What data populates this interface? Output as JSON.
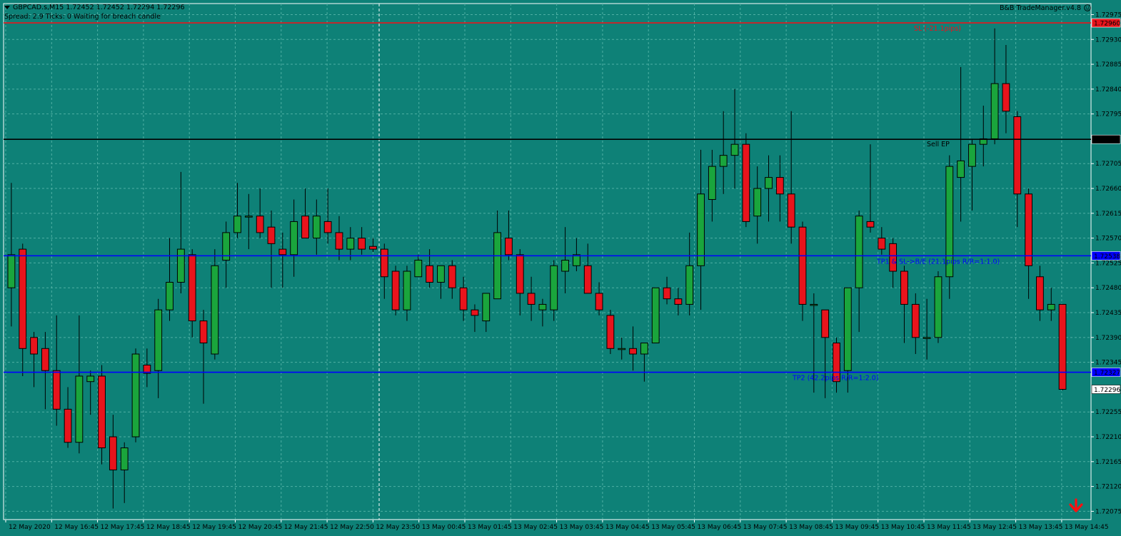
{
  "header": {
    "symbol_line": "GBPCAD.s,M15  1.72452 1.72452 1.72294 1.72296",
    "status_line": "Spread: 2.9   Ticks: 0   Waiting for breach candle",
    "trade_manager": "B&B TradeManager.v4.8"
  },
  "colors": {
    "background": "#0e8177",
    "grid": "#4fb0a4",
    "bull": "#1aa53c",
    "bear": "#e8141c",
    "sl_line": "#e8141c",
    "entry_line": "#000000",
    "tp_line": "#0000ff"
  },
  "levels": {
    "sl": {
      "price": 1.7296,
      "label": "SL (-21.1pips)",
      "axis_tag": "1.72960"
    },
    "entry": {
      "price": 1.72749,
      "label": "Sell EP",
      "axis_tag": "1.72749"
    },
    "tp1": {
      "price": 1.72538,
      "label": "TP1 & SL->B/E (21.1pips R/R=1:1.0)",
      "axis_tag": "1.72538"
    },
    "tp2": {
      "price": 1.72327,
      "label": "TP2 (42.2pips R/R=1:2.0)",
      "axis_tag": "1.72327"
    },
    "bid": {
      "price": 1.72296,
      "axis_tag": "1.72296"
    }
  },
  "price_axis": {
    "min": 1.7206,
    "max": 1.72995,
    "ticks": [
      "1.72975",
      "1.72930",
      "1.72885",
      "1.72840",
      "1.72795",
      "1.72705",
      "1.72660",
      "1.72615",
      "1.72570",
      "1.72525",
      "1.72480",
      "1.72435",
      "1.72390",
      "1.72345",
      "1.72255",
      "1.72210",
      "1.72165",
      "1.72120",
      "1.72075"
    ]
  },
  "time_axis": {
    "labels": [
      "12 May 2020",
      "12 May 16:45",
      "12 May 17:45",
      "12 May 18:45",
      "12 May 19:45",
      "12 May 20:45",
      "12 May 21:45",
      "12 May 22:50",
      "12 May 23:50",
      "13 May 00:45",
      "13 May 01:45",
      "13 May 02:45",
      "13 May 03:45",
      "13 May 04:45",
      "13 May 05:45",
      "13 May 06:45",
      "13 May 07:45",
      "13 May 08:45",
      "13 May 09:45",
      "13 May 10:45",
      "13 May 11:45",
      "13 May 12:45",
      "13 May 13:45",
      "13 May 14:45"
    ]
  },
  "chart_data": {
    "type": "candlestick",
    "series": [
      {
        "o": 1.7248,
        "h": 1.7267,
        "l": 1.7241,
        "c": 1.7254
      },
      {
        "o": 1.7255,
        "h": 1.7256,
        "l": 1.7232,
        "c": 1.7237
      },
      {
        "o": 1.7239,
        "h": 1.724,
        "l": 1.723,
        "c": 1.7236
      },
      {
        "o": 1.7237,
        "h": 1.724,
        "l": 1.7226,
        "c": 1.7233
      },
      {
        "o": 1.7233,
        "h": 1.7243,
        "l": 1.7223,
        "c": 1.7226
      },
      {
        "o": 1.7226,
        "h": 1.723,
        "l": 1.7219,
        "c": 1.722
      },
      {
        "o": 1.722,
        "h": 1.7243,
        "l": 1.7218,
        "c": 1.7232
      },
      {
        "o": 1.7231,
        "h": 1.7233,
        "l": 1.7225,
        "c": 1.7232
      },
      {
        "o": 1.7232,
        "h": 1.7234,
        "l": 1.7216,
        "c": 1.7219
      },
      {
        "o": 1.7221,
        "h": 1.7225,
        "l": 1.7208,
        "c": 1.7215
      },
      {
        "o": 1.7215,
        "h": 1.722,
        "l": 1.7209,
        "c": 1.7219
      },
      {
        "o": 1.7221,
        "h": 1.7237,
        "l": 1.722,
        "c": 1.7236
      },
      {
        "o": 1.7234,
        "h": 1.7237,
        "l": 1.723,
        "c": 1.72325
      },
      {
        "o": 1.7233,
        "h": 1.7246,
        "l": 1.7228,
        "c": 1.7244
      },
      {
        "o": 1.7244,
        "h": 1.7257,
        "l": 1.7242,
        "c": 1.7249
      },
      {
        "o": 1.7249,
        "h": 1.7269,
        "l": 1.7247,
        "c": 1.7255
      },
      {
        "o": 1.7254,
        "h": 1.7255,
        "l": 1.7239,
        "c": 1.7242
      },
      {
        "o": 1.7242,
        "h": 1.7244,
        "l": 1.7227,
        "c": 1.7238
      },
      {
        "o": 1.7236,
        "h": 1.7255,
        "l": 1.7235,
        "c": 1.7252
      },
      {
        "o": 1.7253,
        "h": 1.726,
        "l": 1.7248,
        "c": 1.7258
      },
      {
        "o": 1.7258,
        "h": 1.7267,
        "l": 1.7257,
        "c": 1.7261
      },
      {
        "o": 1.7261,
        "h": 1.7265,
        "l": 1.7255,
        "c": 1.7261
      },
      {
        "o": 1.7261,
        "h": 1.7266,
        "l": 1.7257,
        "c": 1.7258
      },
      {
        "o": 1.7259,
        "h": 1.7262,
        "l": 1.7248,
        "c": 1.7256
      },
      {
        "o": 1.7255,
        "h": 1.7258,
        "l": 1.7248,
        "c": 1.7254
      },
      {
        "o": 1.7254,
        "h": 1.7264,
        "l": 1.725,
        "c": 1.726
      },
      {
        "o": 1.7261,
        "h": 1.7266,
        "l": 1.7257,
        "c": 1.7257
      },
      {
        "o": 1.7257,
        "h": 1.7264,
        "l": 1.7254,
        "c": 1.7261
      },
      {
        "o": 1.726,
        "h": 1.7266,
        "l": 1.7256,
        "c": 1.7258
      },
      {
        "o": 1.7258,
        "h": 1.7261,
        "l": 1.7253,
        "c": 1.7255
      },
      {
        "o": 1.7255,
        "h": 1.7259,
        "l": 1.7253,
        "c": 1.7257
      },
      {
        "o": 1.7257,
        "h": 1.7259,
        "l": 1.7254,
        "c": 1.7255
      },
      {
        "o": 1.72555,
        "h": 1.7257,
        "l": 1.72545,
        "c": 1.7255
      },
      {
        "o": 1.7255,
        "h": 1.7256,
        "l": 1.7246,
        "c": 1.725
      },
      {
        "o": 1.7251,
        "h": 1.7252,
        "l": 1.7243,
        "c": 1.7244
      },
      {
        "o": 1.7244,
        "h": 1.7252,
        "l": 1.7242,
        "c": 1.7251
      },
      {
        "o": 1.725,
        "h": 1.7254,
        "l": 1.725,
        "c": 1.7253
      },
      {
        "o": 1.7252,
        "h": 1.7255,
        "l": 1.7248,
        "c": 1.7249
      },
      {
        "o": 1.7249,
        "h": 1.7252,
        "l": 1.7246,
        "c": 1.7252
      },
      {
        "o": 1.7252,
        "h": 1.7253,
        "l": 1.7246,
        "c": 1.7248
      },
      {
        "o": 1.7248,
        "h": 1.725,
        "l": 1.7242,
        "c": 1.7244
      },
      {
        "o": 1.7244,
        "h": 1.7245,
        "l": 1.724,
        "c": 1.7243
      },
      {
        "o": 1.7242,
        "h": 1.7247,
        "l": 1.724,
        "c": 1.7247
      },
      {
        "o": 1.7246,
        "h": 1.7262,
        "l": 1.7246,
        "c": 1.7258
      },
      {
        "o": 1.7257,
        "h": 1.7262,
        "l": 1.7253,
        "c": 1.7254
      },
      {
        "o": 1.7254,
        "h": 1.7255,
        "l": 1.7243,
        "c": 1.7247
      },
      {
        "o": 1.7247,
        "h": 1.725,
        "l": 1.7242,
        "c": 1.7245
      },
      {
        "o": 1.7244,
        "h": 1.7246,
        "l": 1.7241,
        "c": 1.7245
      },
      {
        "o": 1.7244,
        "h": 1.7253,
        "l": 1.7242,
        "c": 1.7252
      },
      {
        "o": 1.7251,
        "h": 1.7259,
        "l": 1.7247,
        "c": 1.7253
      },
      {
        "o": 1.7252,
        "h": 1.7257,
        "l": 1.7251,
        "c": 1.7254
      },
      {
        "o": 1.7252,
        "h": 1.7256,
        "l": 1.7247,
        "c": 1.7247
      },
      {
        "o": 1.7247,
        "h": 1.7249,
        "l": 1.7243,
        "c": 1.7244
      },
      {
        "o": 1.7243,
        "h": 1.7244,
        "l": 1.7236,
        "c": 1.7237
      },
      {
        "o": 1.7237,
        "h": 1.7239,
        "l": 1.7235,
        "c": 1.7237
      },
      {
        "o": 1.7237,
        "h": 1.7241,
        "l": 1.7233,
        "c": 1.7236
      },
      {
        "o": 1.7236,
        "h": 1.7238,
        "l": 1.7231,
        "c": 1.7238
      },
      {
        "o": 1.7238,
        "h": 1.7248,
        "l": 1.7238,
        "c": 1.7248
      },
      {
        "o": 1.7248,
        "h": 1.725,
        "l": 1.7245,
        "c": 1.7246
      },
      {
        "o": 1.7246,
        "h": 1.7248,
        "l": 1.7243,
        "c": 1.7245
      },
      {
        "o": 1.7245,
        "h": 1.7258,
        "l": 1.7243,
        "c": 1.7252
      },
      {
        "o": 1.7252,
        "h": 1.7273,
        "l": 1.7244,
        "c": 1.7265
      },
      {
        "o": 1.7264,
        "h": 1.7273,
        "l": 1.726,
        "c": 1.727
      },
      {
        "o": 1.727,
        "h": 1.728,
        "l": 1.7265,
        "c": 1.7272
      },
      {
        "o": 1.7272,
        "h": 1.7284,
        "l": 1.7266,
        "c": 1.7274
      },
      {
        "o": 1.7274,
        "h": 1.7276,
        "l": 1.7259,
        "c": 1.726
      },
      {
        "o": 1.7261,
        "h": 1.727,
        "l": 1.7256,
        "c": 1.7266
      },
      {
        "o": 1.7266,
        "h": 1.7272,
        "l": 1.726,
        "c": 1.7268
      },
      {
        "o": 1.7268,
        "h": 1.7272,
        "l": 1.726,
        "c": 1.7265
      },
      {
        "o": 1.7265,
        "h": 1.728,
        "l": 1.7256,
        "c": 1.7259
      },
      {
        "o": 1.7259,
        "h": 1.726,
        "l": 1.7242,
        "c": 1.7245
      },
      {
        "o": 1.7245,
        "h": 1.7247,
        "l": 1.7229,
        "c": 1.7245
      },
      {
        "o": 1.7244,
        "h": 1.7244,
        "l": 1.7228,
        "c": 1.7239
      },
      {
        "o": 1.7238,
        "h": 1.7239,
        "l": 1.7229,
        "c": 1.7231
      },
      {
        "o": 1.7233,
        "h": 1.7248,
        "l": 1.7229,
        "c": 1.7248
      },
      {
        "o": 1.7248,
        "h": 1.7262,
        "l": 1.724,
        "c": 1.7261
      },
      {
        "o": 1.726,
        "h": 1.7274,
        "l": 1.7258,
        "c": 1.7259
      },
      {
        "o": 1.7257,
        "h": 1.7259,
        "l": 1.7254,
        "c": 1.7255
      },
      {
        "o": 1.7256,
        "h": 1.7257,
        "l": 1.7248,
        "c": 1.7251
      },
      {
        "o": 1.7251,
        "h": 1.7252,
        "l": 1.7238,
        "c": 1.7245
      },
      {
        "o": 1.7245,
        "h": 1.7247,
        "l": 1.7236,
        "c": 1.7239
      },
      {
        "o": 1.7239,
        "h": 1.7246,
        "l": 1.7235,
        "c": 1.7239
      },
      {
        "o": 1.7239,
        "h": 1.7251,
        "l": 1.7238,
        "c": 1.725
      },
      {
        "o": 1.725,
        "h": 1.7272,
        "l": 1.7246,
        "c": 1.727
      },
      {
        "o": 1.7268,
        "h": 1.7288,
        "l": 1.726,
        "c": 1.7271
      },
      {
        "o": 1.727,
        "h": 1.7275,
        "l": 1.7262,
        "c": 1.7274
      },
      {
        "o": 1.7274,
        "h": 1.7281,
        "l": 1.727,
        "c": 1.7275
      },
      {
        "o": 1.7275,
        "h": 1.7295,
        "l": 1.7274,
        "c": 1.7285
      },
      {
        "o": 1.7285,
        "h": 1.7292,
        "l": 1.7276,
        "c": 1.728
      },
      {
        "o": 1.7279,
        "h": 1.728,
        "l": 1.7259,
        "c": 1.7265
      },
      {
        "o": 1.7265,
        "h": 1.7266,
        "l": 1.7246,
        "c": 1.7252
      },
      {
        "o": 1.725,
        "h": 1.7252,
        "l": 1.7242,
        "c": 1.7244
      },
      {
        "o": 1.7244,
        "h": 1.7248,
        "l": 1.7242,
        "c": 1.7245
      },
      {
        "o": 1.7245,
        "h": 1.7245,
        "l": 1.72294,
        "c": 1.72296
      }
    ]
  }
}
